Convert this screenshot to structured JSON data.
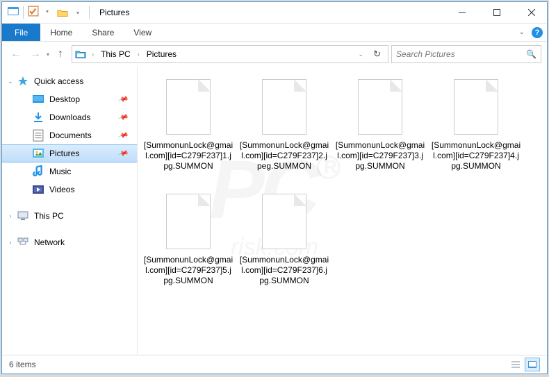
{
  "window": {
    "title": "Pictures"
  },
  "menu": {
    "file": "File",
    "home": "Home",
    "share": "Share",
    "view": "View"
  },
  "breadcrumb": {
    "root": "This PC",
    "folder": "Pictures"
  },
  "search": {
    "placeholder": "Search Pictures"
  },
  "sidebar": {
    "quick_access": "Quick access",
    "desktop": "Desktop",
    "downloads": "Downloads",
    "documents": "Documents",
    "pictures": "Pictures",
    "music": "Music",
    "videos": "Videos",
    "this_pc": "This PC",
    "network": "Network"
  },
  "files": [
    {
      "name": "[SummonunLock@gmail.com][id=C279F237]1.jpg.SUMMON"
    },
    {
      "name": "[SummonunLock@gmail.com][id=C279F237]2.jpeg.SUMMON"
    },
    {
      "name": "[SummonunLock@gmail.com][id=C279F237]3.jpg.SUMMON"
    },
    {
      "name": "[SummonunLock@gmail.com][id=C279F237]4.jpg.SUMMON"
    },
    {
      "name": "[SummonunLock@gmail.com][id=C279F237]5.jpg.SUMMON"
    },
    {
      "name": "[SummonunLock@gmail.com][id=C279F237]6.jpg.SUMMON"
    }
  ],
  "status": {
    "count": "6 items"
  },
  "watermark": {
    "main": "PC",
    "reg": "R",
    "sub": "risk.com"
  }
}
